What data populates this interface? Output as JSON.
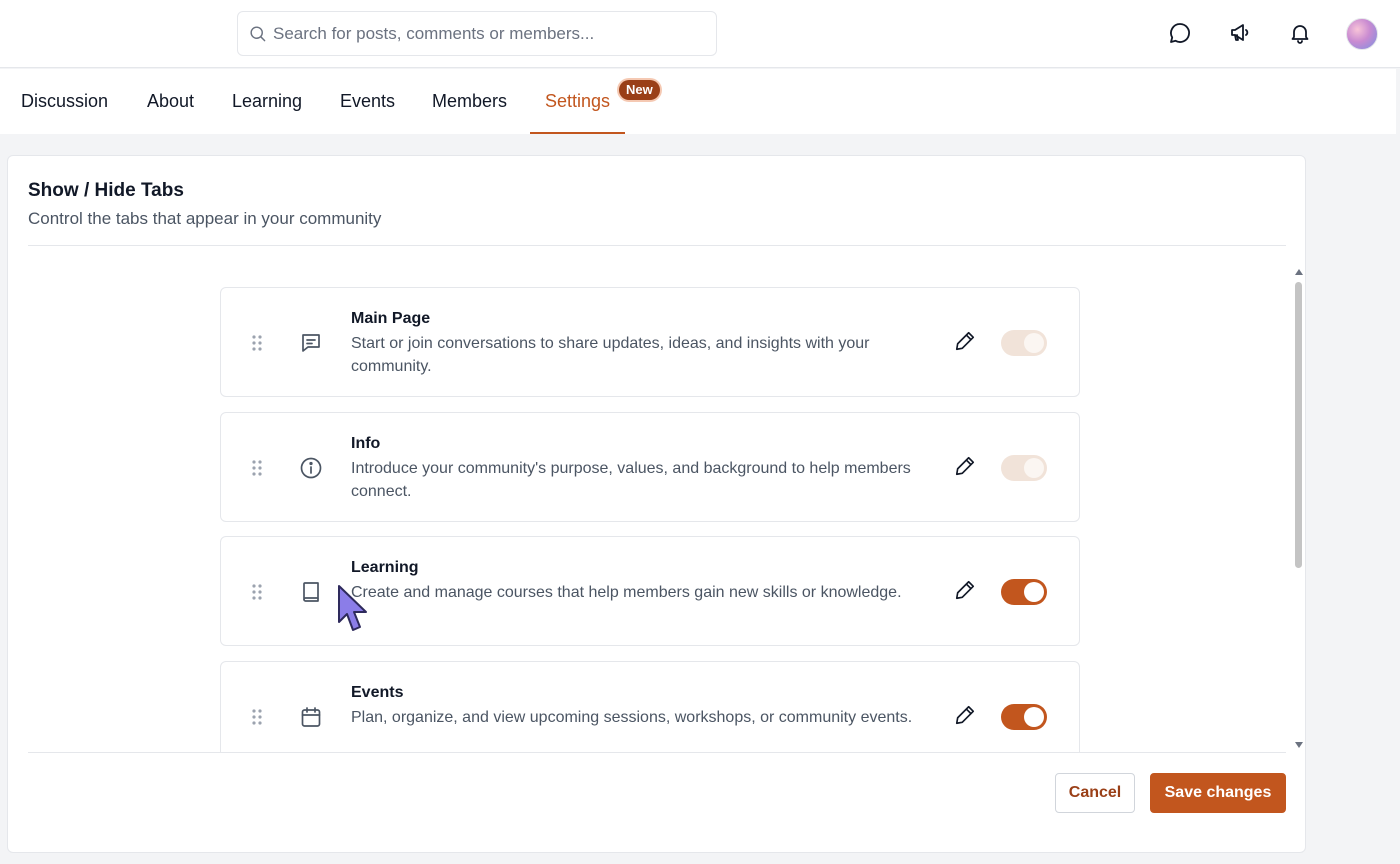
{
  "search": {
    "placeholder": "Search for posts, comments or members..."
  },
  "tabs": [
    {
      "label": "Discussion"
    },
    {
      "label": "About"
    },
    {
      "label": "Learning"
    },
    {
      "label": "Events"
    },
    {
      "label": "Members"
    },
    {
      "label": "Settings",
      "active": true,
      "badge": "New"
    }
  ],
  "section": {
    "title": "Show / Hide Tabs",
    "subtitle": "Control the tabs that appear in your community"
  },
  "items": [
    {
      "title": "Main Page",
      "description": "Start or join conversations to share updates, ideas, and insights with your community.",
      "icon": "chat-icon",
      "enabled": true,
      "locked": true
    },
    {
      "title": "Info",
      "description": "Introduce your community's purpose, values, and background to help members connect.",
      "icon": "info-icon",
      "enabled": true,
      "locked": true
    },
    {
      "title": "Learning",
      "description": "Create and manage courses that help members gain new skills or knowledge.",
      "icon": "book-icon",
      "enabled": true,
      "locked": false
    },
    {
      "title": "Events",
      "description": "Plan, organize, and view upcoming sessions, workshops, or community events.",
      "icon": "calendar-icon",
      "enabled": true,
      "locked": false
    }
  ],
  "buttons": {
    "cancel": "Cancel",
    "save": "Save changes"
  },
  "colors": {
    "accent": "#c2561e",
    "badge": "#9a3f17",
    "toggle_disabled": "#f1e3d9"
  }
}
